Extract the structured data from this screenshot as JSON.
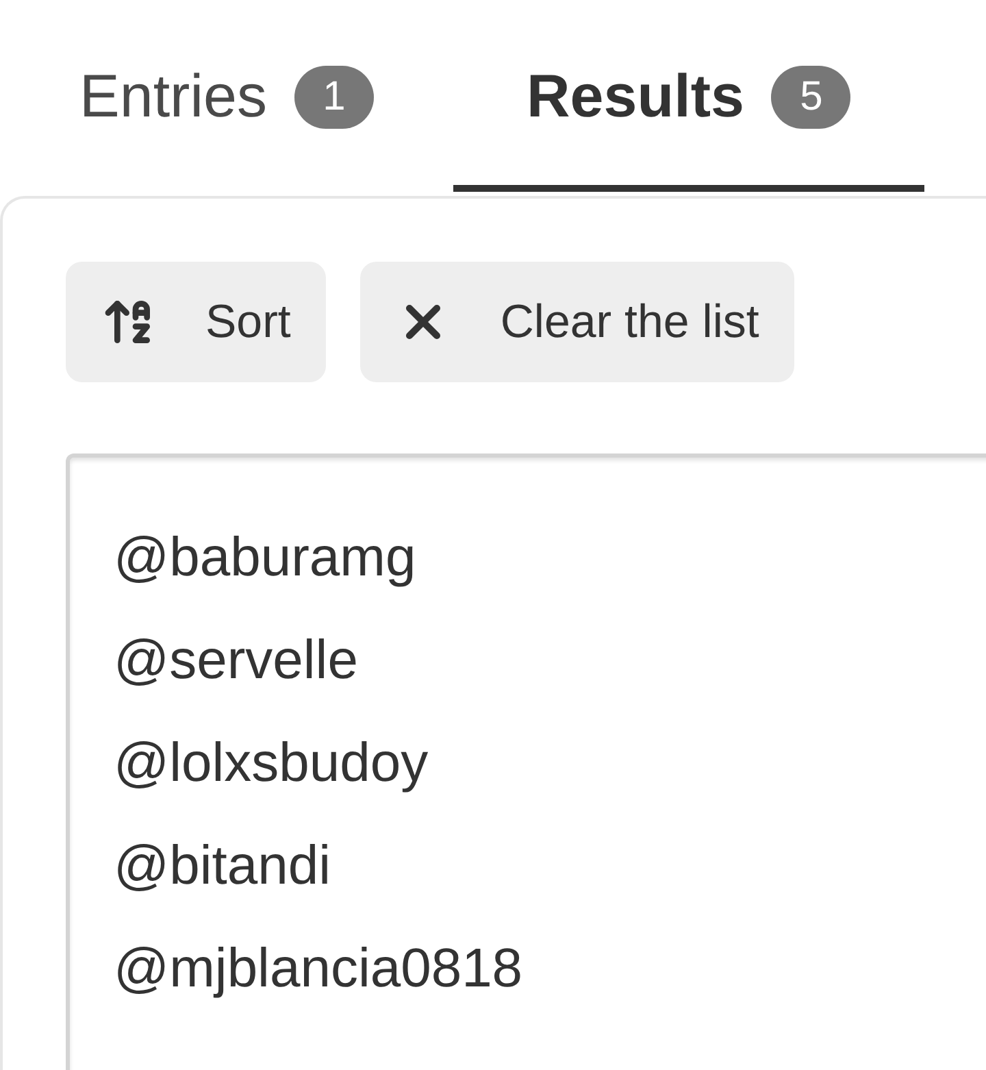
{
  "tabs": [
    {
      "label": "Entries",
      "badge": "1",
      "selected": false
    },
    {
      "label": "Results",
      "badge": "5",
      "selected": true
    }
  ],
  "buttons": [
    {
      "kind": "sort",
      "label": "Sort"
    },
    {
      "kind": "clear",
      "label": "Clear the list"
    }
  ],
  "results": [
    "@baburamg",
    "@servelle",
    "@lolxsbudoy",
    "@bitandi",
    "@mjblancia0818"
  ]
}
